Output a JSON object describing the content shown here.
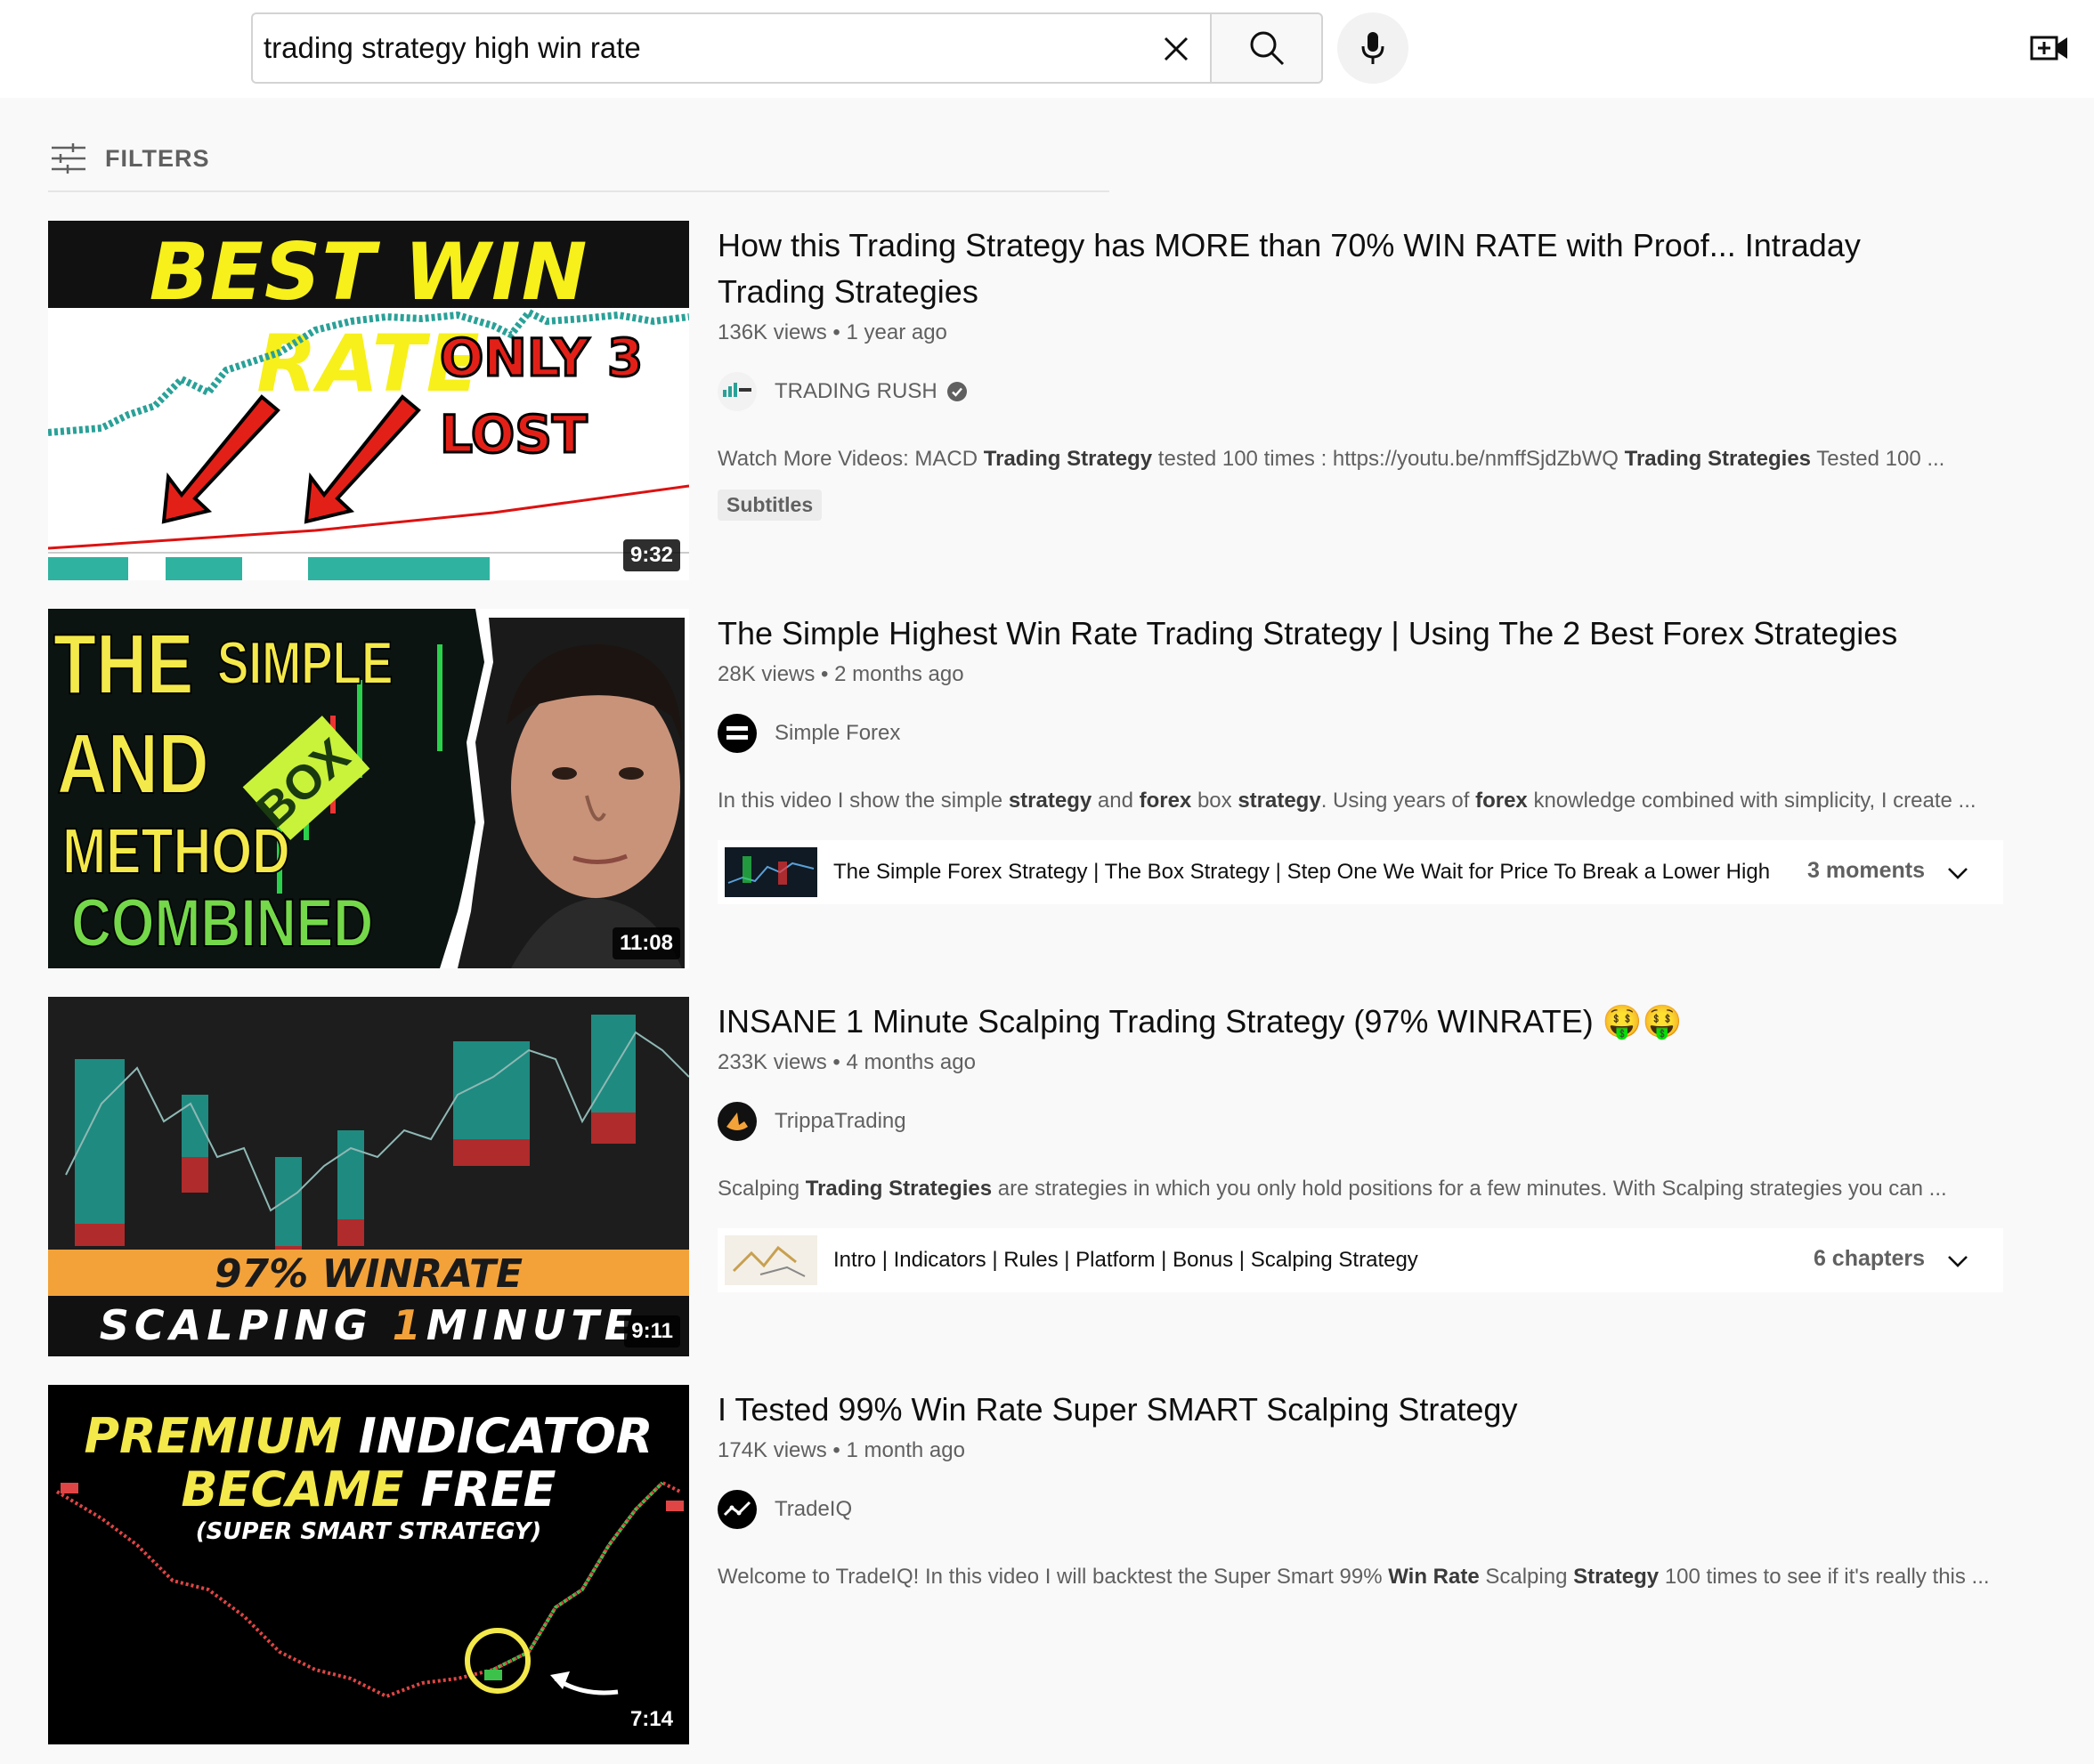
{
  "search": {
    "query": "trading strategy high win rate"
  },
  "header": {
    "clear_icon": "close-icon",
    "search_icon": "search-icon",
    "mic_icon": "microphone-icon",
    "create_icon": "video-create-icon"
  },
  "filters": {
    "label": "FILTERS",
    "icon": "filter-sliders-icon"
  },
  "results": [
    {
      "title_line1": "How this Trading Strategy has MORE than 70% WIN RATE with Proof... Intraday",
      "title_line2": "Trading Strategies",
      "views": "136K views",
      "age": "1 year ago",
      "channel": "TRADING RUSH",
      "verified": true,
      "desc_parts": [
        "Watch More Videos: MACD ",
        "Trading Strategy",
        " tested 100 times : https://youtu.be/nmffSjdZbWQ ",
        "Trading Strategies",
        " Tested 100 ..."
      ],
      "badge": "Subtitles",
      "duration": "9:32",
      "thumb": {
        "headline": "BEST WIN RATE",
        "callout_line1": "ONLY 3",
        "callout_line2": "LOST"
      }
    },
    {
      "title": "The Simple Highest Win Rate Trading Strategy | Using The 2 Best Forex Strategies",
      "views": "28K views",
      "age": "2 months ago",
      "channel": "Simple Forex",
      "desc_parts": [
        "In this video I show the simple ",
        "strategy",
        " and ",
        "forex",
        " box ",
        "strategy",
        ". Using years of ",
        "forex",
        " knowledge combined with simplicity, I create ..."
      ],
      "chapters_text": "The Simple Forex Strategy | The Box Strategy | Step One We Wait for Price To Break a Lower High",
      "chapters_count": "3 moments",
      "duration": "11:08",
      "thumb": {
        "line_the": "THE",
        "line_simple": "SIMPLE",
        "line_and": "AND",
        "line_box": "BOX",
        "line_method": "METHOD",
        "line_combined": "COMBINED"
      }
    },
    {
      "title": "INSANE 1 Minute Scalping Trading Strategy (97% WINRATE) 🤑🤑",
      "views": "233K views",
      "age": "4 months ago",
      "channel": "TrippaTrading",
      "desc_parts": [
        "Scalping ",
        "Trading Strategies",
        " are strategies in which you only hold positions for a few minutes. With Scalping strategies you can ..."
      ],
      "chapters_text": "Intro | Indicators | Rules | Platform | Bonus | Scalping Strategy",
      "chapters_count": "6 chapters",
      "duration": "9:11",
      "thumb": {
        "band": "97% WINRATE",
        "bottom_a": "SCALPING ",
        "bottom_b": "1",
        "bottom_c": "MINUTE"
      }
    },
    {
      "title": "I Tested 99% Win Rate Super SMART Scalping Strategy",
      "views": "174K views",
      "age": "1 month ago",
      "channel": "TradeIQ",
      "desc_parts": [
        "Welcome to TradeIQ! In this video I will backtest the Super Smart 99% ",
        "Win Rate",
        " Scalping ",
        "Strategy",
        " 100 times to see if it's really this ..."
      ],
      "duration": "7:14",
      "thumb": {
        "line1_a": "PREMIUM",
        "line1_b": " INDICATOR",
        "line2_a": "BECAME",
        "line2_b": " FREE",
        "line3": "(SUPER SMART STRATEGY)"
      }
    }
  ],
  "colors": {
    "background": "#f9f9f9",
    "header": "#ffffff",
    "text_primary": "#0f0f0f",
    "text_secondary": "#606060"
  }
}
